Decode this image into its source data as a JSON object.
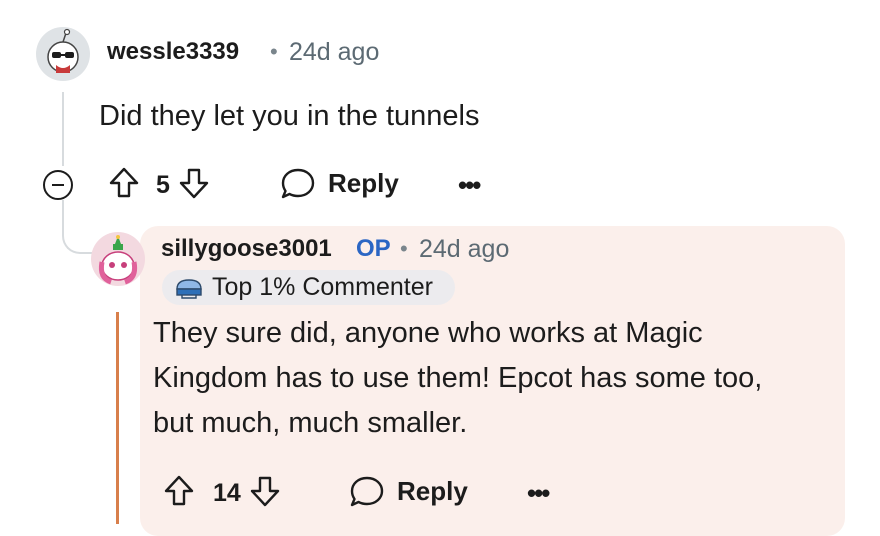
{
  "comment": {
    "username": "wessle3339",
    "separator": "•",
    "age": "24d ago",
    "body": "Did they let you in the tunnels",
    "votes": "5",
    "reply_label": "Reply",
    "more_label": "•••"
  },
  "reply": {
    "username": "sillygoose3001",
    "op_badge": "OP",
    "separator": "•",
    "age": "24d ago",
    "flair": "Top 1% Commenter",
    "body_lines": [
      "They sure did, anyone who works at Magic",
      "Kingdom has to use them! Epcot has some too,",
      "but much, much smaller."
    ],
    "votes": "14",
    "reply_label": "Reply",
    "more_label": "•••"
  },
  "colors": {
    "op_badge": "#2b66c4",
    "highlight_bg": "#fbefeb",
    "quote_bar": "#d87f4b",
    "flair_bg": "#ecebee",
    "thread_line": "#d7dbde"
  }
}
